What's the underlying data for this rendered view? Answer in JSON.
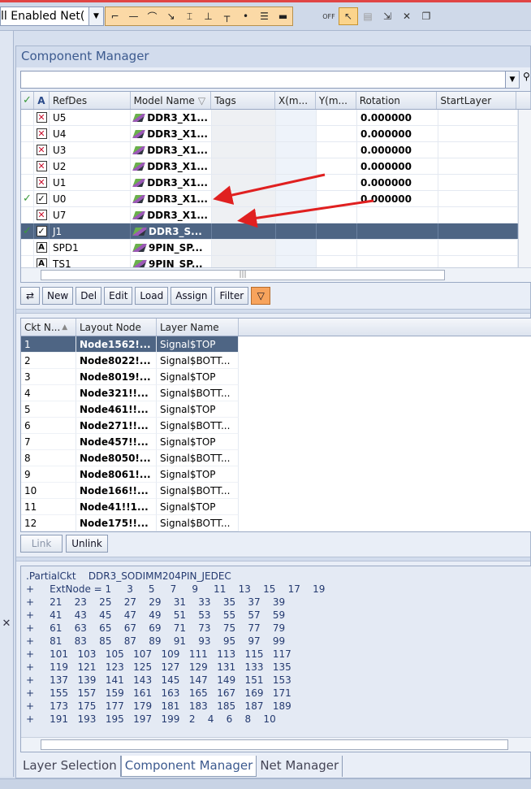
{
  "toolbar": {
    "net_filter_value": "ll Enabled Net(",
    "tools": [
      "pin-icon",
      "line-icon",
      "trace-icon",
      "trace-down-icon",
      "via-icon",
      "ground-icon",
      "tee-icon",
      "dot-icon",
      "list-icon",
      "bar-icon"
    ],
    "tools2": [
      {
        "name": "off-toggle-icon",
        "glyph": "OFF"
      },
      {
        "name": "select-arrow-icon",
        "glyph": "↖"
      },
      {
        "name": "properties-icon",
        "glyph": "▤"
      },
      {
        "name": "move-icon",
        "glyph": "⇲"
      },
      {
        "name": "delete-icon",
        "glyph": "✕"
      },
      {
        "name": "copy-icon",
        "glyph": "❐"
      }
    ]
  },
  "panel": {
    "title": "Component Manager"
  },
  "components": {
    "columns": [
      "RefDes",
      "Model Name",
      "Tags",
      "X(m...",
      "Y(m...",
      "Rotation",
      "StartLayer"
    ],
    "rows": [
      {
        "refdes": "U5",
        "model": "DDR3_X1...",
        "rotation": "0.000000",
        "state": "x",
        "green": false
      },
      {
        "refdes": "U4",
        "model": "DDR3_X1...",
        "rotation": "0.000000",
        "state": "x",
        "green": false
      },
      {
        "refdes": "U3",
        "model": "DDR3_X1...",
        "rotation": "0.000000",
        "state": "x",
        "green": false
      },
      {
        "refdes": "U2",
        "model": "DDR3_X1...",
        "rotation": "0.000000",
        "state": "x",
        "green": false
      },
      {
        "refdes": "U1",
        "model": "DDR3_X1...",
        "rotation": "0.000000",
        "state": "x",
        "green": false
      },
      {
        "refdes": "U0",
        "model": "DDR3_X1...",
        "rotation": "0.000000",
        "state": "check",
        "green": true
      },
      {
        "refdes": "U7",
        "model": "DDR3_X1...",
        "rotation": "",
        "state": "x",
        "green": false
      },
      {
        "refdes": "J1",
        "model": "DDR3_S...",
        "rotation": "",
        "state": "check",
        "green": true,
        "selected": true
      },
      {
        "refdes": "SPD1",
        "model": "9PIN_SP...",
        "rotation": "",
        "state": "A",
        "green": false
      },
      {
        "refdes": "TS1",
        "model": "9PIN_SP...",
        "rotation": "",
        "state": "A",
        "green": false
      }
    ]
  },
  "buttons1": [
    "New",
    "Del",
    "Edit",
    "Load",
    "Assign",
    "Filter"
  ],
  "pins": {
    "columns": [
      "Ckt N...",
      "Layout Node",
      "Layer Name"
    ],
    "rows": [
      {
        "n": "1",
        "node": "Node1562!...",
        "layer": "Signal$TOP"
      },
      {
        "n": "2",
        "node": "Node8022!...",
        "layer": "Signal$BOTT..."
      },
      {
        "n": "3",
        "node": "Node8019!...",
        "layer": "Signal$TOP"
      },
      {
        "n": "4",
        "node": "Node321!!...",
        "layer": "Signal$BOTT..."
      },
      {
        "n": "5",
        "node": "Node461!!...",
        "layer": "Signal$TOP"
      },
      {
        "n": "6",
        "node": "Node271!!...",
        "layer": "Signal$BOTT..."
      },
      {
        "n": "7",
        "node": "Node457!!...",
        "layer": "Signal$TOP"
      },
      {
        "n": "8",
        "node": "Node8050!...",
        "layer": "Signal$BOTT..."
      },
      {
        "n": "9",
        "node": "Node8061!...",
        "layer": "Signal$TOP"
      },
      {
        "n": "10",
        "node": "Node166!!...",
        "layer": "Signal$BOTT..."
      },
      {
        "n": "11",
        "node": "Node41!!1...",
        "layer": "Signal$TOP"
      },
      {
        "n": "12",
        "node": "Node175!!...",
        "layer": "Signal$BOTT..."
      }
    ]
  },
  "buttons2": [
    "Link",
    "Unlink"
  ],
  "netlist": [
    ".PartialCkt    DDR3_SODIMM204PIN_JEDEC",
    "+     ExtNode = 1     3     5     7     9     11    13    15    17    19",
    "+     21    23    25    27    29    31    33    35    37    39",
    "+     41    43    45    47    49    51    53    55    57    59",
    "+     61    63    65    67    69    71    73    75    77    79",
    "+     81    83    85    87    89    91    93    95    97    99",
    "+     101   103   105   107   109   111   113   115   117",
    "+     119   121   123   125   127   129   131   133   135",
    "+     137   139   141   143   145   147   149   151   153",
    "+     155   157   159   161   163   165   167   169   171",
    "+     173   175   177   179   181   183   185   187   189",
    "+     191   193   195   197   199   2    4    6    8    10"
  ],
  "tabs": [
    "Layer Selection",
    "Component Manager",
    "Net Manager"
  ]
}
